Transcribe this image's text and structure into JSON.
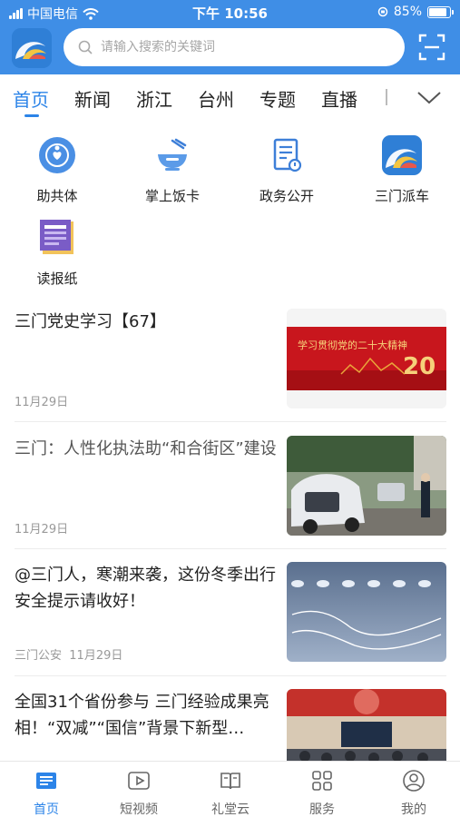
{
  "status_bar": {
    "carrier": "中国电信",
    "time": "下午 10:56",
    "battery": "85%",
    "battery_level": 0.85
  },
  "search": {
    "placeholder": "请输入搜索的关键词"
  },
  "tabs": [
    {
      "label": "首页",
      "active": true
    },
    {
      "label": "新闻"
    },
    {
      "label": "浙江"
    },
    {
      "label": "台州"
    },
    {
      "label": "专题"
    },
    {
      "label": "直播"
    }
  ],
  "quick_links": [
    {
      "label": "助共体",
      "icon": "heart-hands-icon"
    },
    {
      "label": "掌上饭卡",
      "icon": "bowl-icon"
    },
    {
      "label": "政务公开",
      "icon": "document-icon"
    },
    {
      "label": "三门派车",
      "icon": "app-logo-icon"
    },
    {
      "label": "读报纸",
      "icon": "newspaper-icon"
    }
  ],
  "news": [
    {
      "title": "三门党史学习【67】",
      "source": "",
      "date": "11月29日",
      "thumb_text": "学习贯彻党的二十大精神"
    },
    {
      "title": "三门：人性化执法助“和合街区”建设",
      "source": "",
      "date": "11月29日"
    },
    {
      "title": "@三门人，寒潮来袭，这份冬季出行安全提示请收好！",
      "source": "三门公安",
      "date": "11月29日"
    },
    {
      "title": "全国31个省份参与 三门经验成果亮相！“双减”“国信”背景下新型…",
      "source": "",
      "date": ""
    }
  ],
  "tabbar": [
    {
      "label": "首页",
      "icon": "news-icon",
      "active": true
    },
    {
      "label": "短视频",
      "icon": "video-icon"
    },
    {
      "label": "礼堂云",
      "icon": "book-icon"
    },
    {
      "label": "服务",
      "icon": "grid-icon"
    },
    {
      "label": "我的",
      "icon": "user-icon"
    }
  ],
  "colors": {
    "brand": "#3f8ee6",
    "accent": "#2c84e8",
    "text": "#222222",
    "muted": "#999999"
  }
}
